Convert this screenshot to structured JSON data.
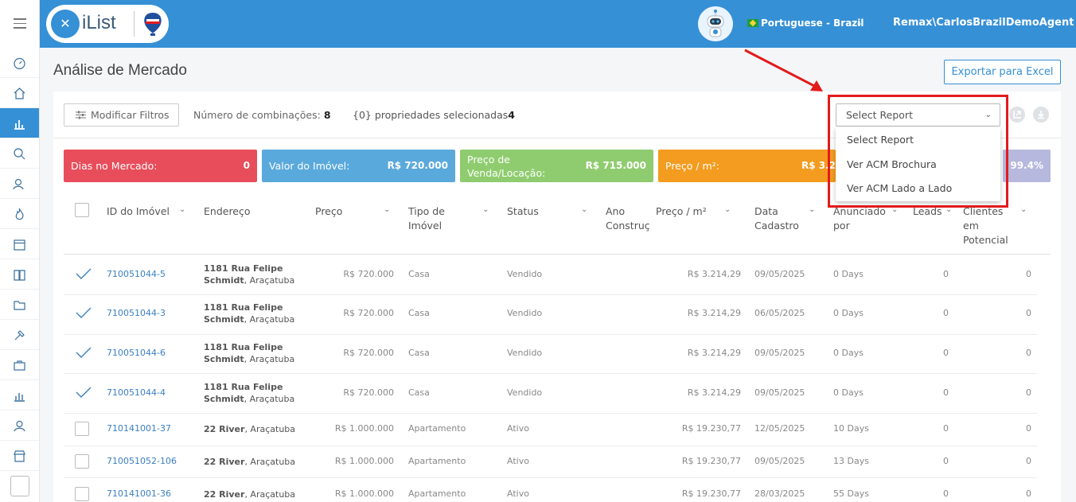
{
  "header": {
    "logo_text": "iList",
    "language": "Portuguese - Brazil",
    "user": "Remax\\CarlosBrazilDemoAgent"
  },
  "page": {
    "title": "Análise de Mercado",
    "export_label": "Exportar para Excel"
  },
  "filters": {
    "modify_label": "Modificar Filtros",
    "combos_label": "Número de combinações:",
    "combos_count": "8",
    "selected_label": "{0} propriedades selecionadas",
    "selected_count": "4"
  },
  "report": {
    "selected": "Select Report",
    "options": [
      "Select Report",
      "Ver ACM Brochura",
      "Ver ACM Lado a Lado"
    ]
  },
  "cards": [
    {
      "label": "Dias no Mercado:",
      "value": "0",
      "color": "#e84d5b"
    },
    {
      "label": "Valor do Imóvel:",
      "value": "R$ 720.000",
      "color": "#5aa9dc"
    },
    {
      "label": "Preço de Venda/Locação:",
      "value": "R$ 715.000",
      "color": "#8fcc6f"
    },
    {
      "label": "Preço / m²:",
      "value": "R$ 3.2",
      "color": "#f39c1f"
    },
    {
      "label": "",
      "value": "99.4%",
      "color": "#b6b8dd"
    }
  ],
  "table": {
    "headers": [
      "ID do Imóvel",
      "Endereço",
      "Preço",
      "Tipo de Imóvel",
      "Status",
      "Ano Construção",
      "Preço / m²",
      "Data Cadastro",
      "Anunciado por",
      "Leads",
      "Clientes em Potencial"
    ],
    "rows": [
      {
        "checked": true,
        "id": "710051044-5",
        "street": "1181 Rua Felipe Schmidt",
        "city": ", Araçatuba",
        "price": "R$ 720.000",
        "type": "Casa",
        "status": "Vendido",
        "ppm": "R$ 3.214,29",
        "date": "09/05/2025",
        "listed": "0 Days",
        "leads": "0",
        "clients": "0"
      },
      {
        "checked": true,
        "id": "710051044-3",
        "street": "1181 Rua Felipe Schmidt",
        "city": ", Araçatuba",
        "price": "R$ 720.000",
        "type": "Casa",
        "status": "Vendido",
        "ppm": "R$ 3.214,29",
        "date": "06/05/2025",
        "listed": "0 Days",
        "leads": "0",
        "clients": "0"
      },
      {
        "checked": true,
        "id": "710051044-6",
        "street": "1181 Rua Felipe Schmidt",
        "city": ", Araçatuba",
        "price": "R$ 720.000",
        "type": "Casa",
        "status": "Vendido",
        "ppm": "R$ 3.214,29",
        "date": "09/05/2025",
        "listed": "0 Days",
        "leads": "0",
        "clients": "0"
      },
      {
        "checked": true,
        "id": "710051044-4",
        "street": "1181 Rua Felipe Schmidt",
        "city": ", Araçatuba",
        "price": "R$ 720.000",
        "type": "Casa",
        "status": "Vendido",
        "ppm": "R$ 3.214,29",
        "date": "09/05/2025",
        "listed": "0 Days",
        "leads": "0",
        "clients": "0"
      },
      {
        "checked": false,
        "id": "710141001-37",
        "street": "22 River",
        "city": ", Araçatuba",
        "price": "R$ 1.000.000",
        "type": "Apartamento",
        "status": "Ativo",
        "ppm": "R$ 19.230,77",
        "date": "12/05/2025",
        "listed": "10 Days",
        "leads": "0",
        "clients": "0"
      },
      {
        "checked": false,
        "id": "710051052-106",
        "street": "22 River",
        "city": ", Araçatuba",
        "price": "R$ 1.000.000",
        "type": "Apartamento",
        "status": "Ativo",
        "ppm": "R$ 19.230,77",
        "date": "09/05/2025",
        "listed": "13 Days",
        "leads": "0",
        "clients": "0"
      },
      {
        "checked": false,
        "id": "710141001-36",
        "street": "22 River",
        "city": ", Araçatuba",
        "price": "R$ 1.000.000",
        "type": "Apartamento",
        "status": "Ativo",
        "ppm": "R$ 19.230,77",
        "date": "28/03/2025",
        "listed": "55 Days",
        "leads": "0",
        "clients": "0"
      }
    ]
  },
  "colors": {
    "brand": "#3590d6",
    "highlight": "#e31b1b"
  }
}
